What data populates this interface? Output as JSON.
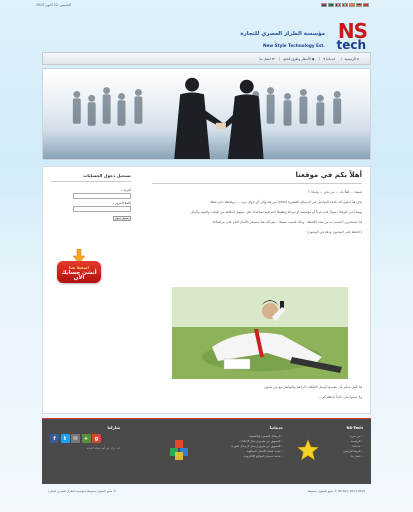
{
  "topbar": {
    "date": "الخميس، 12 أكتوبر 2015",
    "flags": [
      "english-flag",
      "arabic-flag",
      "french-flag",
      "italian-flag",
      "spanish-flag",
      "german-flag",
      "turkish-flag"
    ]
  },
  "header": {
    "logo_ns": "NS",
    "logo_tech": "tech",
    "logo_sub": "NEW STYLE TECHNOLOGY",
    "company_ar": "مؤسسة الطراز العصري للتجارة",
    "company_en": "New Style Technology Est."
  },
  "nav": {
    "items": [
      {
        "label": "الرئيسية",
        "icon": "home-icon"
      },
      {
        "label": "خدماتنا",
        "icon": "dropdown-icon"
      },
      {
        "label": "الأسعار وطرق الدفع",
        "icon": "tag-icon"
      },
      {
        "label": "اتصل بنا",
        "icon": "mail-icon"
      }
    ]
  },
  "main": {
    "title": "أهلاً بكم في موقعنا",
    "paragraphs": [
      "ضيفنا ... أهلاً بك ... من نحن ... ولماذا ؟",
      "نحن هنا لنكون لك نافذة للتواصل عبر الرسائل القصيرة (sms) من هنا وإلى أي جوال تريد .... وبلحظة ذاتي فقط",
      "يهمنا أنتي حاولتك ،سواءً كنت فرداً أو مؤسسة أو شركة وتطبيقاً احترافية تساعدك على تسهيل التكلفة من الوقت والجهد والمال .",
      "إذا تستتحرين أحسنت به من هذه اللحظة ، وذلك لسبب بسيط .. هو أنك هنا ستشعر بالأمان التام على مراسلاتك",
      "(حافظة على المحتوى ودقة في الوصول)"
    ],
    "closing": [
      "إذا تأمل منكم بأن تتقدموا أوصل الخلقات الرائعة والتواصل مع من تحبون",
      "ولا تنسوا نحن دائماً بانتظاركم ..."
    ]
  },
  "sidebar": {
    "login_title": "تسجيل دخول الحسابات",
    "email_label": "البريد :",
    "password_label": "كلمة المرور :",
    "login_button": "تسجيل دخول",
    "register_line1": "اضغط هنا",
    "register_line2": "أنشئ حسابك الآن"
  },
  "footer": {
    "brand_title": "NS-Tech",
    "brand_items": [
      "من نحن؟",
      "الرئيسية",
      "خدماتنا",
      "الربط البرمجي",
      "اتصل بنا"
    ],
    "services_title": "خدماتنا",
    "services_items": [
      "الرسائل القصيرة والتطبيقية",
      "التسويق عن طريق إرسال الإعلانات",
      "التسويق عن طريق إرسال الرسائل الفورية",
      "تحديد شبكة الإتصال المطلوبة",
      "خدمة تسجيل المواقع الإلكترونية"
    ],
    "share_title": "شاركنا",
    "share_note": "أنت تزائر في أهم شبكة النقدية",
    "social_icons": [
      "facebook-icon",
      "twitter-icon",
      "email-icon",
      "share-icon",
      "google-plus-icon"
    ]
  },
  "copyright": {
    "left": "© جميع الحقوق محفوظة لمؤسسة الطراز العصري للتجارة",
    "right": "NS-Tech 2013-2015 © جميع الحقوق محفوظة"
  },
  "colors": {
    "brand_red": "#c81a1a",
    "brand_blue": "#1d3e8c",
    "footer_bg": "#4a4a4a"
  }
}
